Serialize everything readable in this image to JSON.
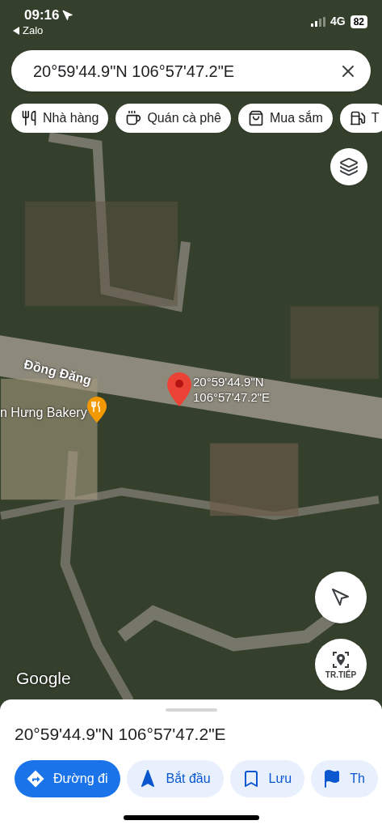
{
  "status_bar": {
    "time": "09:16",
    "back_app": "Zalo",
    "network": "4G",
    "battery": "82"
  },
  "search": {
    "value": "20°59'44.9\"N 106°57'47.2\"E"
  },
  "chips": [
    {
      "kind": "restaurant",
      "label": "Nhà hàng"
    },
    {
      "kind": "cafe",
      "label": "Quán cà phê"
    },
    {
      "kind": "shopping",
      "label": "Mua sắm"
    },
    {
      "kind": "gas",
      "label": "T"
    }
  ],
  "map": {
    "street_label": "Đồng Đăng",
    "place_label": "n Hưng Bakery",
    "pin_label": [
      "20°59'44.9\"N",
      "106°57'47.2\"E"
    ],
    "live_view_label": "TR.TIẾP",
    "attribution": "Google"
  },
  "sheet": {
    "title": "20°59'44.9\"N 106°57'47.2\"E",
    "actions": [
      {
        "kind": "directions",
        "label": "Đường đi",
        "primary": true
      },
      {
        "kind": "start",
        "label": "Bắt đầu",
        "primary": false
      },
      {
        "kind": "save",
        "label": "Lưu",
        "primary": false
      },
      {
        "kind": "flag",
        "label": "Th",
        "primary": false
      }
    ]
  }
}
